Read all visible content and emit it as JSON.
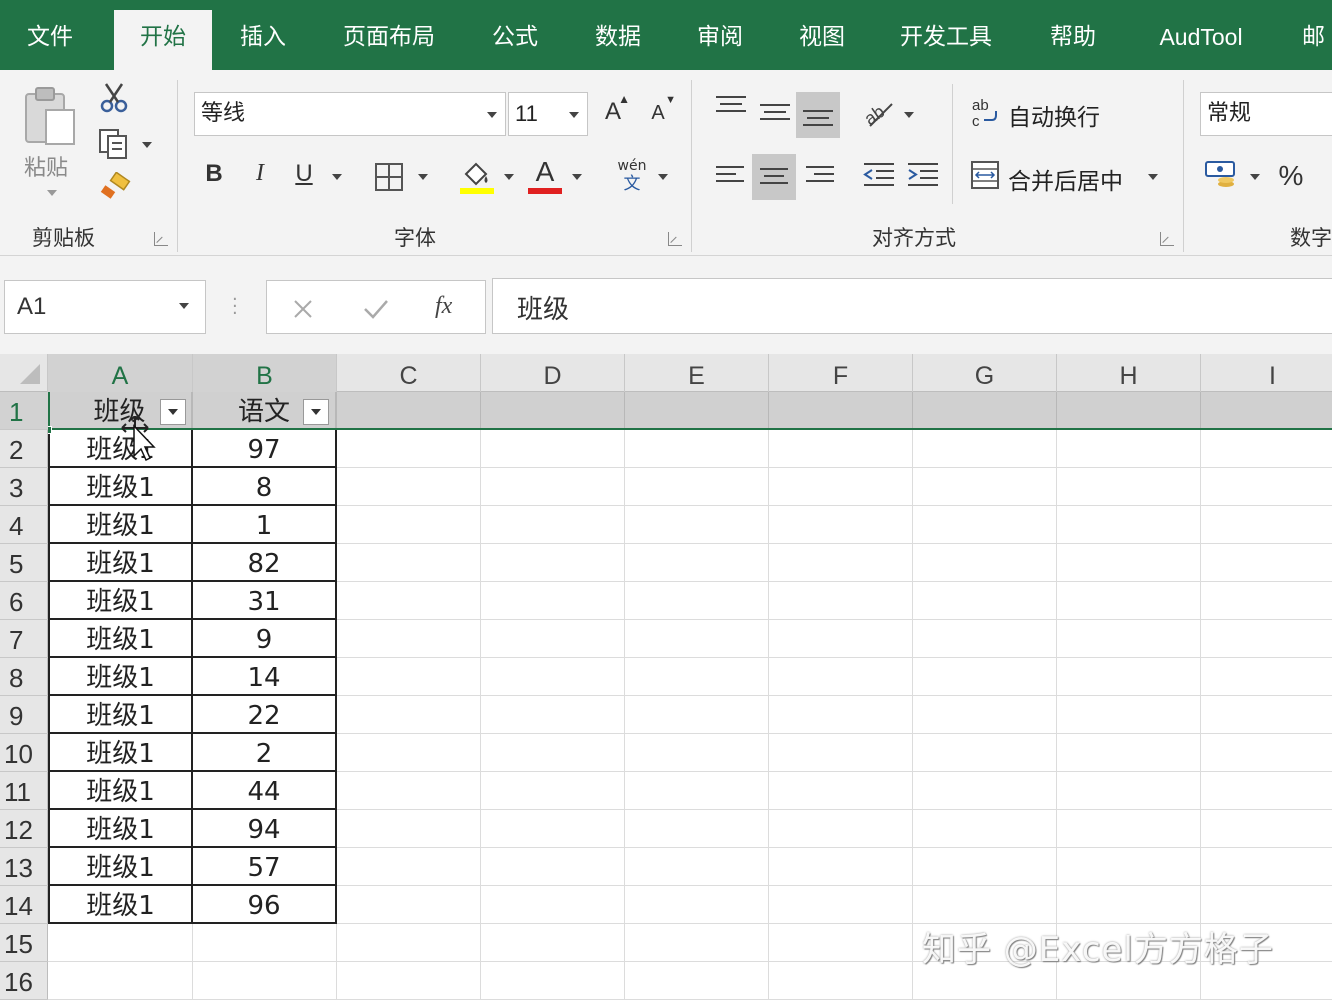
{
  "menu": {
    "tabs": [
      "文件",
      "开始",
      "插入",
      "页面布局",
      "公式",
      "数据",
      "审阅",
      "视图",
      "开发工具",
      "帮助",
      "AudTool",
      "邮"
    ],
    "active": "开始"
  },
  "ribbon": {
    "clipboard": {
      "paste_label": "粘贴",
      "group_label": "剪贴板"
    },
    "font": {
      "font_name": "等线",
      "font_size": "11",
      "bold": "B",
      "italic": "I",
      "underline": "U",
      "group_label": "字体",
      "fill_color": "#ffff00",
      "font_color": "#ff0000",
      "phonetic_top": "wén",
      "phonetic_bottom": "文"
    },
    "alignment": {
      "wrap_text": "自动换行",
      "merge_center": "合并后居中",
      "group_label": "对齐方式"
    },
    "number": {
      "format": "常规",
      "percent": "%",
      "group_label": "数字"
    }
  },
  "formula_bar": {
    "name_box": "A1",
    "fx": "fx",
    "content": "班级"
  },
  "sheet": {
    "columns": [
      "A",
      "B",
      "C",
      "D",
      "E",
      "F",
      "G",
      "H",
      "I"
    ],
    "rows": [
      "1",
      "2",
      "3",
      "4",
      "5",
      "6",
      "7",
      "8",
      "9",
      "10",
      "11",
      "12",
      "13",
      "14",
      "15",
      "16"
    ],
    "header": [
      "班级",
      "语文"
    ],
    "data": [
      [
        "班级1",
        "97"
      ],
      [
        "班级1",
        "8"
      ],
      [
        "班级1",
        "1"
      ],
      [
        "班级1",
        "82"
      ],
      [
        "班级1",
        "31"
      ],
      [
        "班级1",
        "9"
      ],
      [
        "班级1",
        "14"
      ],
      [
        "班级1",
        "22"
      ],
      [
        "班级1",
        "2"
      ],
      [
        "班级1",
        "44"
      ],
      [
        "班级1",
        "94"
      ],
      [
        "班级1",
        "57"
      ],
      [
        "班级1",
        "96"
      ]
    ]
  },
  "watermark": "知乎 @Excel方方格子",
  "colors": {
    "accent": "#217346",
    "selection": "#d0d0d0"
  }
}
